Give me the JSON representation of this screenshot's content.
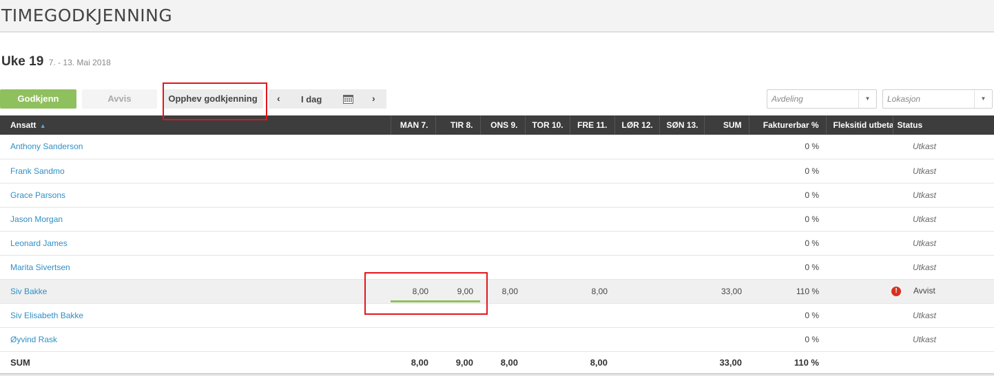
{
  "app": {
    "title": "TIMEGODKJENNING"
  },
  "week": {
    "label": "Uke 19",
    "range": "7. - 13. Mai 2018"
  },
  "toolbar": {
    "approve_label": "Godkjenn",
    "reject_label": "Avvis",
    "revoke_label": "Opphev godkjenning",
    "prev_symbol": "‹",
    "today_label": "I dag",
    "next_symbol": "›"
  },
  "filters": {
    "department_placeholder": "Avdeling",
    "location_placeholder": "Lokasjon"
  },
  "table": {
    "columns": {
      "name": "Ansatt",
      "mon": "MAN 7.",
      "tue": "TIR 8.",
      "wed": "ONS 9.",
      "thu": "TOR 10.",
      "fri": "FRE 11.",
      "sat": "LØR 12.",
      "sun": "SØN 13.",
      "sum": "SUM",
      "billable": "Fakturerbar %",
      "flex": "Fleksitid utbetalt",
      "status": "Status"
    },
    "sort_indicator": "▲",
    "rows": [
      {
        "name": "Anthony Sanderson",
        "mon": "",
        "tue": "",
        "wed": "",
        "thu": "",
        "fri": "",
        "sat": "",
        "sun": "",
        "sum": "",
        "billable": "0 %",
        "flex": "",
        "status": "Utkast"
      },
      {
        "name": "Frank Sandmo",
        "mon": "",
        "tue": "",
        "wed": "",
        "thu": "",
        "fri": "",
        "sat": "",
        "sun": "",
        "sum": "",
        "billable": "0 %",
        "flex": "",
        "status": "Utkast"
      },
      {
        "name": "Grace Parsons",
        "mon": "",
        "tue": "",
        "wed": "",
        "thu": "",
        "fri": "",
        "sat": "",
        "sun": "",
        "sum": "",
        "billable": "0 %",
        "flex": "",
        "status": "Utkast"
      },
      {
        "name": "Jason Morgan",
        "mon": "",
        "tue": "",
        "wed": "",
        "thu": "",
        "fri": "",
        "sat": "",
        "sun": "",
        "sum": "",
        "billable": "0 %",
        "flex": "",
        "status": "Utkast"
      },
      {
        "name": "Leonard James",
        "mon": "",
        "tue": "",
        "wed": "",
        "thu": "",
        "fri": "",
        "sat": "",
        "sun": "",
        "sum": "",
        "billable": "0 %",
        "flex": "",
        "status": "Utkast"
      },
      {
        "name": "Marita Sivertsen",
        "mon": "",
        "tue": "",
        "wed": "",
        "thu": "",
        "fri": "",
        "sat": "",
        "sun": "",
        "sum": "",
        "billable": "0 %",
        "flex": "",
        "status": "Utkast"
      },
      {
        "name": "Siv Bakke",
        "mon": "8,00",
        "tue": "9,00",
        "wed": "8,00",
        "thu": "",
        "fri": "8,00",
        "sat": "",
        "sun": "",
        "sum": "33,00",
        "billable": "110 %",
        "flex": "",
        "status": "Avvist"
      },
      {
        "name": "Siv Elisabeth Bakke",
        "mon": "",
        "tue": "",
        "wed": "",
        "thu": "",
        "fri": "",
        "sat": "",
        "sun": "",
        "sum": "",
        "billable": "0 %",
        "flex": "",
        "status": "Utkast"
      },
      {
        "name": "Øyvind Rask",
        "mon": "",
        "tue": "",
        "wed": "",
        "thu": "",
        "fri": "",
        "sat": "",
        "sun": "",
        "sum": "",
        "billable": "0 %",
        "flex": "",
        "status": "Utkast"
      }
    ],
    "footer": {
      "label": "SUM",
      "mon": "8,00",
      "tue": "9,00",
      "wed": "8,00",
      "thu": "",
      "fri": "8,00",
      "sat": "",
      "sun": "",
      "sum": "33,00",
      "billable": "110 %"
    }
  },
  "colors": {
    "accent_green": "#8fc05e",
    "header_dark": "#3d3d3d",
    "link_blue": "#2e8fc6",
    "error_red": "#d9301f",
    "annotation_red": "#e3141a"
  },
  "icons": {
    "calendar": "calendar-icon",
    "warning": "warning-icon",
    "sort": "sort-ascending-icon"
  }
}
